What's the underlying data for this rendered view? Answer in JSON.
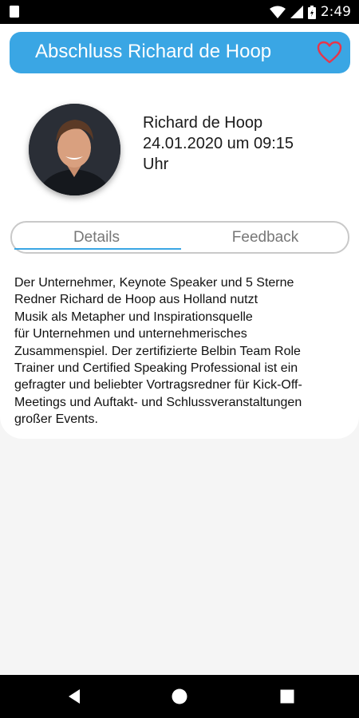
{
  "status_bar": {
    "time": "2:49",
    "icons": [
      "notification-icon",
      "wifi-icon",
      "signal-icon",
      "battery-icon"
    ]
  },
  "header": {
    "title": "Abschluss Richard de Hoop",
    "favorite_icon": "heart-outline-icon"
  },
  "profile": {
    "name": "Richard de Hoop",
    "date_line1": "24.01.2020 um 09:15",
    "date_line2": "Uhr"
  },
  "tabs": [
    {
      "label": "Details",
      "active": true
    },
    {
      "label": "Feedback",
      "active": false
    }
  ],
  "description": {
    "lines": [
      "Der Unternehmer, Keynote Speaker und 5 Sterne",
      "Redner Richard de Hoop aus Holland nutzt",
      "Musik als Metapher und Inspirationsquelle",
      "für Unternehmen und unternehmerisches",
      "Zusammenspiel. Der zertifizierte Belbin Team Role",
      "Trainer und Certified Speaking Professional ist ein",
      "gefragter und beliebter Vortragsredner für Kick-Off-",
      "Meetings und Auftakt- und Schlussveranstaltungen",
      "großer Events."
    ]
  },
  "nav_bar": {
    "buttons": [
      "back-icon",
      "home-icon",
      "recents-icon"
    ]
  },
  "colors": {
    "accent": "#3aa6e4",
    "heart": "#e8354a",
    "background": "#f5f5f5"
  }
}
